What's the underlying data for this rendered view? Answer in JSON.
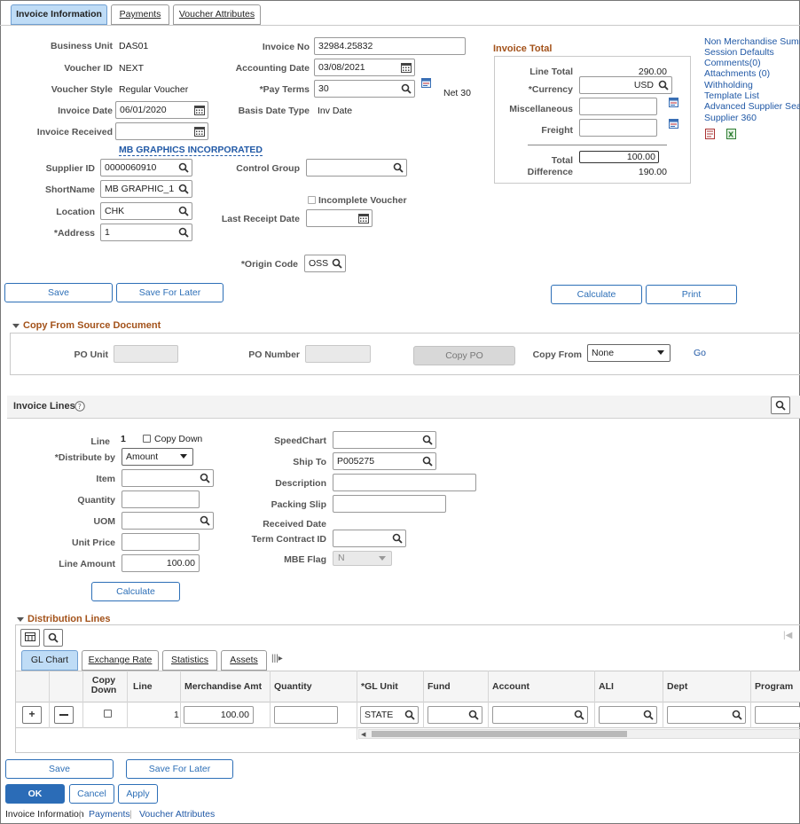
{
  "tabs": [
    "Invoice Information",
    "Payments",
    "Voucher Attributes"
  ],
  "header": {
    "business_unit_label": "Business Unit",
    "business_unit": "DAS01",
    "voucher_id_label": "Voucher ID",
    "voucher_id": "NEXT",
    "voucher_style_label": "Voucher Style",
    "voucher_style": "Regular Voucher",
    "invoice_date_label": "Invoice Date",
    "invoice_date": "06/01/2020",
    "invoice_received_label": "Invoice Received",
    "invoice_received": "",
    "supplier_name": "MB GRAPHICS INCORPORATED",
    "supplier_id_label": "Supplier ID",
    "supplier_id": "0000060910",
    "shortname_label": "ShortName",
    "shortname": "MB GRAPHIC_1",
    "location_label": "Location",
    "location": "CHK",
    "address_label": "*Address",
    "address": "1",
    "invoice_no_label": "Invoice No",
    "invoice_no": "32984.25832",
    "accounting_date_label": "Accounting Date",
    "accounting_date": "03/08/2021",
    "pay_terms_label": "*Pay Terms",
    "pay_terms": "30",
    "pay_terms_desc": "Net 30",
    "basis_date_type_label": "Basis Date Type",
    "basis_date_type": "Inv Date",
    "control_group_label": "Control Group",
    "control_group": "",
    "incomplete_voucher_label": "Incomplete Voucher",
    "last_receipt_date_label": "Last Receipt Date",
    "last_receipt_date": "",
    "origin_code_label": "*Origin Code",
    "origin_code": "OSS"
  },
  "invoice_total": {
    "title": "Invoice Total",
    "line_total_label": "Line Total",
    "line_total": "290.00",
    "currency_label": "*Currency",
    "currency": "USD",
    "misc_label": "Miscellaneous",
    "misc": "",
    "freight_label": "Freight",
    "freight": "",
    "total_label": "Total",
    "total": "100.00",
    "difference_label": "Difference",
    "difference": "190.00"
  },
  "side_links": [
    "Non Merchandise Summary",
    "Session Defaults",
    "Comments(0)",
    "Attachments (0)",
    "Withholding",
    "Template List",
    "Advanced Supplier Search",
    "Supplier 360"
  ],
  "buttons": {
    "save": "Save",
    "save_for_later": "Save For Later",
    "calculate": "Calculate",
    "print": "Print",
    "copy_po": "Copy PO",
    "go": "Go",
    "line_calculate": "Calculate",
    "bottom_save": "Save",
    "bottom_save_for_later": "Save For Later",
    "ok": "OK",
    "cancel": "Cancel",
    "apply": "Apply"
  },
  "copy_from": {
    "title": "Copy From Source Document",
    "po_unit_label": "PO Unit",
    "po_unit": "",
    "po_number_label": "PO Number",
    "po_number": "",
    "copy_from_label": "Copy From",
    "copy_from_value": "None"
  },
  "invoice_lines": {
    "title": "Invoice Lines",
    "line_label": "Line",
    "line": "1",
    "copy_down_label": "Copy Down",
    "distribute_by_label": "*Distribute by",
    "distribute_by": "Amount",
    "item_label": "Item",
    "item": "",
    "quantity_label": "Quantity",
    "quantity": "",
    "uom_label": "UOM",
    "uom": "",
    "unit_price_label": "Unit Price",
    "unit_price": "",
    "line_amount_label": "Line Amount",
    "line_amount": "100.00",
    "speedchart_label": "SpeedChart",
    "speedchart": "",
    "ship_to_label": "Ship To",
    "ship_to": "P005275",
    "description_label": "Description",
    "description": "",
    "packing_slip_label": "Packing Slip",
    "packing_slip": "",
    "received_date_label": "Received Date",
    "term_contract_label": "Term Contract ID",
    "term_contract": "",
    "mbe_flag_label": "MBE Flag",
    "mbe_flag": "N"
  },
  "distribution": {
    "title": "Distribution Lines",
    "tabs": [
      "GL Chart",
      "Exchange Rate",
      "Statistics",
      "Assets"
    ],
    "columns": [
      "Copy Down",
      "Line",
      "Merchandise Amt",
      "Quantity",
      "*GL Unit",
      "Fund",
      "Account",
      "ALI",
      "Dept",
      "Program"
    ],
    "row": {
      "line": "1",
      "merchandise_amt": "100.00",
      "quantity": "",
      "gl_unit": "STATE",
      "fund": "",
      "account": "",
      "ali": "",
      "dept": "",
      "program": ""
    }
  },
  "footer_links": [
    "Invoice Information",
    "Payments",
    "Voucher Attributes"
  ]
}
